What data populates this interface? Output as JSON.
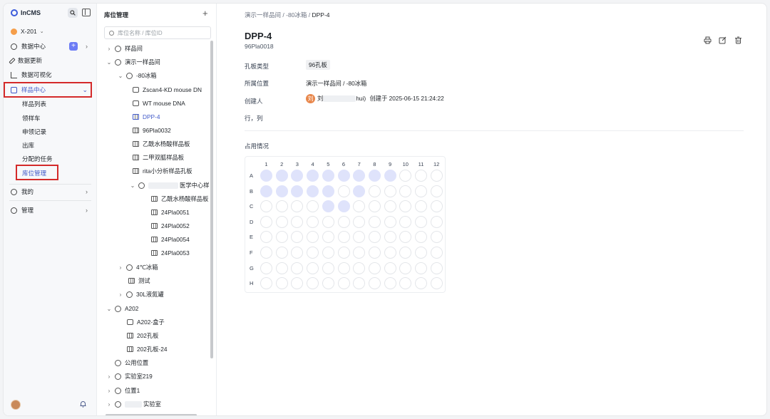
{
  "app": {
    "name": "InCMS"
  },
  "workspace": {
    "name": "X-201"
  },
  "sidebar": {
    "items": [
      {
        "label": "数据中心"
      },
      {
        "label": "数据更新"
      },
      {
        "label": "数据可视化"
      },
      {
        "label": "样品中心"
      },
      {
        "label": "我的"
      },
      {
        "label": "管理"
      }
    ],
    "sub_items": [
      "样品列表",
      "领样车",
      "申领记录",
      "出库",
      "分配的任务",
      "库位管理"
    ]
  },
  "tree": {
    "title": "库位管理",
    "search_placeholder": "库位名称 / 库位ID",
    "nodes": [
      {
        "label": "样品间"
      },
      {
        "label": "演示一样品间"
      },
      {
        "label": "-80冰箱"
      },
      {
        "label": "Zscan4-KD mouse DN"
      },
      {
        "label": "WT mouse DNA"
      },
      {
        "label": "DPP-4"
      },
      {
        "label": "96Pla0032"
      },
      {
        "label": "乙酰水杨酸样品板"
      },
      {
        "label": "二甲双胍样品板"
      },
      {
        "label": "rita小分析样品孔板"
      },
      {
        "label": "医学中心样"
      },
      {
        "label": "乙酰水杨酸样品板"
      },
      {
        "label": "24Pla0051"
      },
      {
        "label": "24Pla0052"
      },
      {
        "label": "24Pla0054"
      },
      {
        "label": "24Pla0053"
      },
      {
        "label": "4℃冰箱"
      },
      {
        "label": "测试"
      },
      {
        "label": "30L液氮罐"
      },
      {
        "label": "A202"
      },
      {
        "label": "A202-盒子"
      },
      {
        "label": "202孔板"
      },
      {
        "label": "202孔板-24"
      },
      {
        "label": "公用位置"
      },
      {
        "label": "实验室219"
      },
      {
        "label": "位置1"
      },
      {
        "label": "实验室"
      }
    ]
  },
  "detail": {
    "breadcrumb": {
      "part1": "演示一样品间",
      "sep": " / ",
      "part2": "-80冰箱",
      "part3": "DPP-4"
    },
    "title": "DPP-4",
    "code": "96Pla0018",
    "fields": {
      "plate_type_label": "孔板类型",
      "plate_type_value": "96孔板",
      "location_label": "所属位置",
      "location_value": "演示一样品间 / -80冰箱",
      "creator_label": "创建人",
      "creator_avatar": "刘",
      "creator_name": "刘",
      "creator_name_tail": "hui)",
      "created_text": "创建于 2025-06-15 21:24:22",
      "rowcol_label": "行，列"
    },
    "occupancy_title": "占用情况",
    "plate": {
      "columns": [
        "1",
        "2",
        "3",
        "4",
        "5",
        "6",
        "7",
        "8",
        "9",
        "10",
        "11",
        "12"
      ],
      "rows": [
        "A",
        "B",
        "C",
        "D",
        "E",
        "F",
        "G",
        "H"
      ],
      "occupied": {
        "A": [
          1,
          2,
          3,
          4,
          5,
          6,
          7,
          8,
          9
        ],
        "B": [
          1,
          2,
          3,
          4,
          5,
          7
        ],
        "C": [
          5,
          6
        ]
      }
    }
  }
}
